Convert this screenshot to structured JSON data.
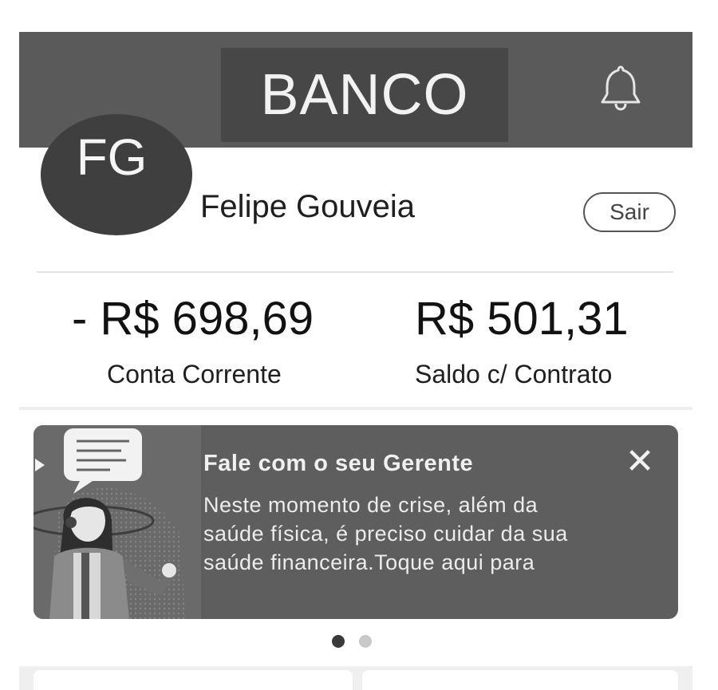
{
  "header": {
    "brand": "BANCO",
    "notifications_icon": "bell-icon"
  },
  "profile": {
    "initials": "FG",
    "name": "Felipe Gouveia",
    "logout_label": "Sair"
  },
  "balances": [
    {
      "value": "- R$ 698,69",
      "label": "Conta Corrente"
    },
    {
      "value": "R$ 501,31",
      "label": "Saldo c/ Contrato"
    }
  ],
  "banner": {
    "title": "Fale com o seu Gerente",
    "body": "Neste momento de crise, além da saúde física, é preciso cuidar da sua saúde financeira.Toque aqui para",
    "close_icon": "close-icon",
    "illustration": "woman-with-headset-illustration"
  },
  "carousel": {
    "current": 1,
    "total": 2
  },
  "colors": {
    "header_bg": "#5a5a5a",
    "brand_box": "#474747",
    "banner_bg": "#5e5e5e",
    "avatar_bg": "#3f3f3f"
  }
}
